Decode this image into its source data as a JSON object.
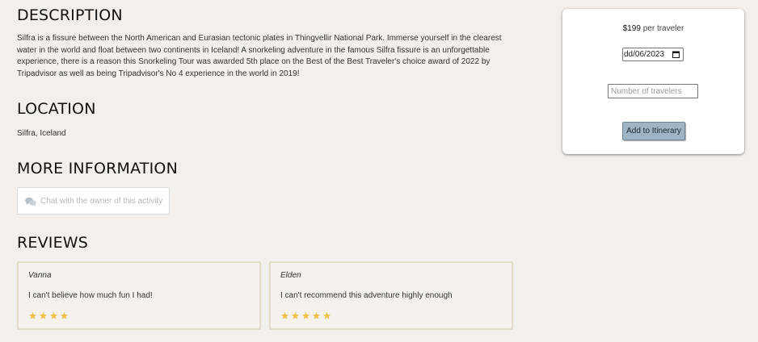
{
  "description": {
    "title": "DESCRIPTION",
    "text": "Silfra is a fissure between the North American and Eurasian tectonic plates in Thingvellir National Park. Immerse yourself in the clearest water in the world and float between two continents in Iceland! A snorkeling adventure in the famous Silfra fissure is an unforgettable experience, there is a reason this Snorkeling Tour was awarded 5th place on the Best of the Best Traveler's choice award of 2022 by Tripadvisor as well as being Tripadvisor's No 4 experience in the world in 2019!"
  },
  "location": {
    "title": "LOCATION",
    "text": "Silfra, Iceland"
  },
  "more_info": {
    "title": "MORE INFORMATION",
    "chat_placeholder": "Chat with the owner of this activity",
    "chat_icon": "chat-bubbles-icon"
  },
  "reviews": {
    "title": "REVIEWS",
    "star_color": "#f0c14b",
    "items": [
      {
        "name": "Vanna",
        "text": "I can't believe how much fun I had!",
        "rating": 4
      },
      {
        "name": "Elden",
        "text": "I can't recommend this adventure highly enough",
        "rating": 5
      }
    ]
  },
  "booking": {
    "price": "$199",
    "price_unit": "per traveler",
    "date_value": "dd/06/2023",
    "travelers_placeholder": "Number of travelers",
    "add_button_label": "Add to Itinerary",
    "button_color": "#9fb5c5"
  }
}
